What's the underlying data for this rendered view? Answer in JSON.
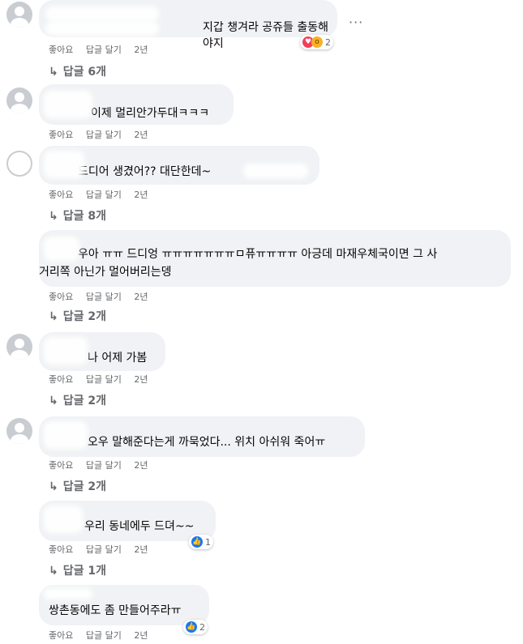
{
  "comments": [
    {
      "text": "지갑 챙겨라 공쥬들 출동해야지",
      "like": "좋아요",
      "reply": "답글 달기",
      "time": "2년",
      "reaction_count": "2",
      "replies": "답글 6개"
    },
    {
      "text": "이제 멀리안가두대ㅋㅋㅋ",
      "like": "좋아요",
      "reply": "답글 달기",
      "time": "2년"
    },
    {
      "text": "드디어 생겼어?? 대단한데~",
      "like": "좋아요",
      "reply": "답글 달기",
      "time": "2년",
      "replies": "답글 8개"
    },
    {
      "text": "우아 ㅠㅠ 드디엉 ㅠㅠㅠㅠㅠㅠㅠㅁ퓨ㅠㅠㅠㅠ 아긍데 마재우체국이면 그 사",
      "text2": "거리쪽 아닌가 멀어버리는뎅",
      "like": "좋아요",
      "reply": "답글 달기",
      "time": "2년",
      "replies": "답글 2개"
    },
    {
      "text": "나 어제 가봄",
      "like": "좋아요",
      "reply": "답글 달기",
      "time": "2년",
      "replies": "답글 2개"
    },
    {
      "text": "오우 말해준다는게 까묵었다... 위치 아쉬워 죽어ㅠ",
      "like": "좋아요",
      "reply": "답글 달기",
      "time": "2년",
      "replies": "답글 2개"
    },
    {
      "text": "우리 동네에두 드뎌~~",
      "like": "좋아요",
      "reply": "답글 달기",
      "time": "2년",
      "reaction_count": "1",
      "replies": "답글 1개"
    },
    {
      "text": "쌍촌동에도 좀 만들어주라ㅠ",
      "like": "좋아요",
      "reply": "답글 달기",
      "time": "2년",
      "reaction_count": "2"
    }
  ],
  "more_icon": "···",
  "reply_arrow": "↳"
}
